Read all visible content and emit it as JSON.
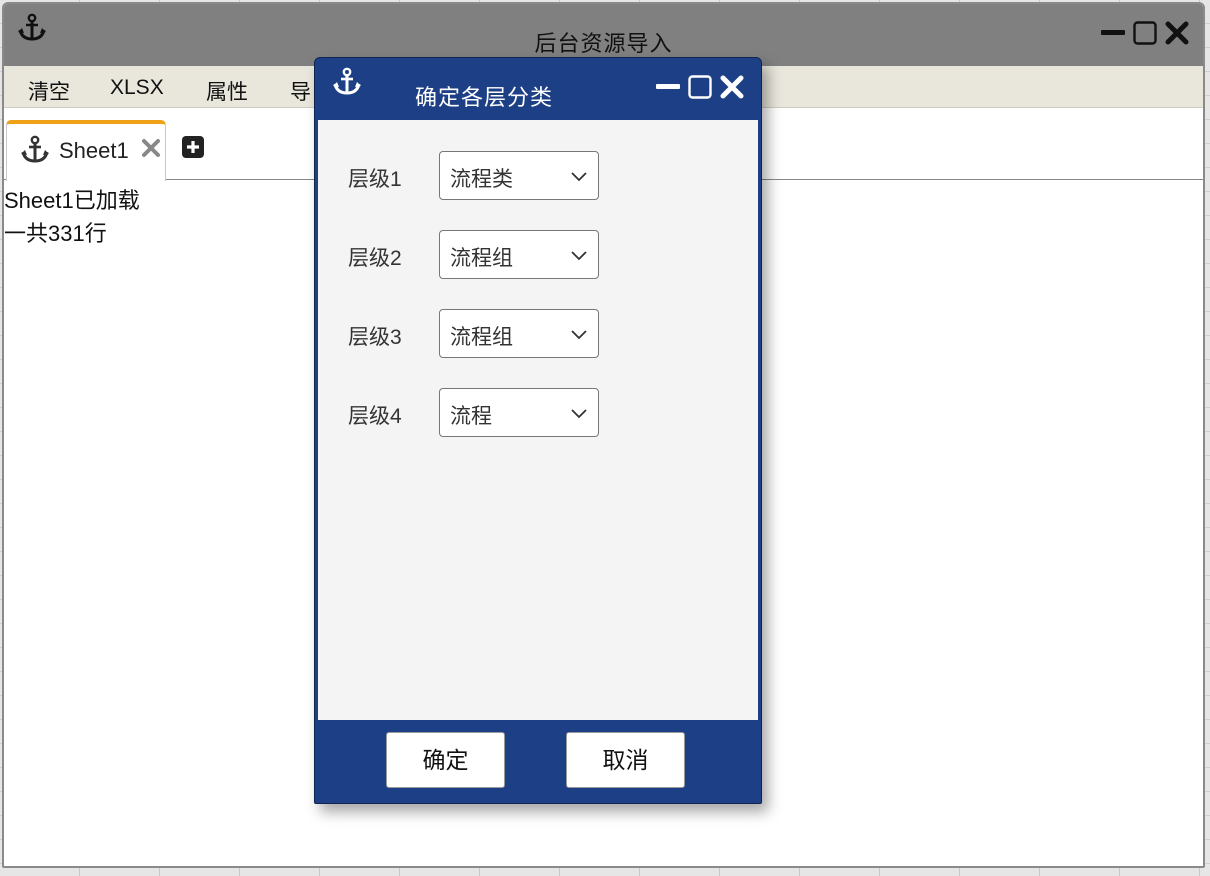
{
  "main_window": {
    "title": "后台资源导入"
  },
  "menu": {
    "items": [
      "清空",
      "XLSX",
      "属性",
      "导"
    ]
  },
  "tabs": {
    "sheet_label": "Sheet1"
  },
  "content": {
    "lines": [
      "Sheet1已加载",
      "一共331行"
    ]
  },
  "dialog": {
    "title": "确定各层分类",
    "levels": [
      {
        "label": "层级1",
        "value": "流程类"
      },
      {
        "label": "层级2",
        "value": "流程组"
      },
      {
        "label": "层级3",
        "value": "流程组"
      },
      {
        "label": "层级4",
        "value": "流程"
      }
    ],
    "ok_label": "确定",
    "cancel_label": "取消"
  },
  "colors": {
    "dialog_accent": "#1d3f85",
    "main_titlebar": "#808080",
    "tab_accent": "#f0a11a"
  },
  "icons": {
    "app": "anchor-icon",
    "minimize": "minimize-icon",
    "maximize": "maximize-icon",
    "close": "close-icon",
    "add_tab": "plus-square-icon",
    "dropdown": "chevron-down-icon"
  }
}
